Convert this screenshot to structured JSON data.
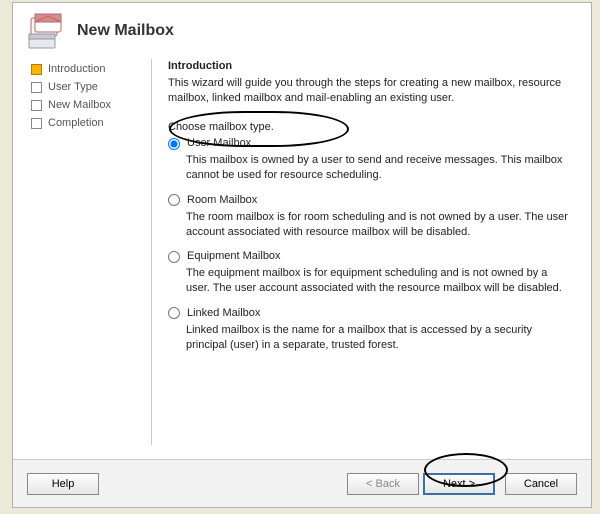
{
  "header": {
    "title": "New Mailbox"
  },
  "steps": [
    {
      "label": "Introduction",
      "active": true
    },
    {
      "label": "User Type",
      "active": false
    },
    {
      "label": "New Mailbox",
      "active": false
    },
    {
      "label": "Completion",
      "active": false
    }
  ],
  "content": {
    "heading": "Introduction",
    "intro": "This wizard will guide you through the steps for creating a new mailbox, resource mailbox, linked mailbox and mail-enabling an existing user.",
    "choose_label": "Choose mailbox type.",
    "options": [
      {
        "label": "User Mailbox",
        "desc": "This mailbox is owned by a user to send and receive messages. This mailbox cannot be used for resource scheduling.",
        "selected": true
      },
      {
        "label": "Room Mailbox",
        "desc": "The room mailbox is for room scheduling and is not owned by a user. The user account associated with resource mailbox will be disabled.",
        "selected": false
      },
      {
        "label": "Equipment Mailbox",
        "desc": "The equipment mailbox is for equipment scheduling and is not owned by a user. The user account associated with the resource mailbox will be disabled.",
        "selected": false
      },
      {
        "label": "Linked Mailbox",
        "desc": "Linked mailbox is the name for a mailbox that is accessed by a security principal (user) in a separate, trusted forest.",
        "selected": false
      }
    ]
  },
  "footer": {
    "help": "Help",
    "back": "< Back",
    "next": "Next >",
    "cancel": "Cancel"
  }
}
